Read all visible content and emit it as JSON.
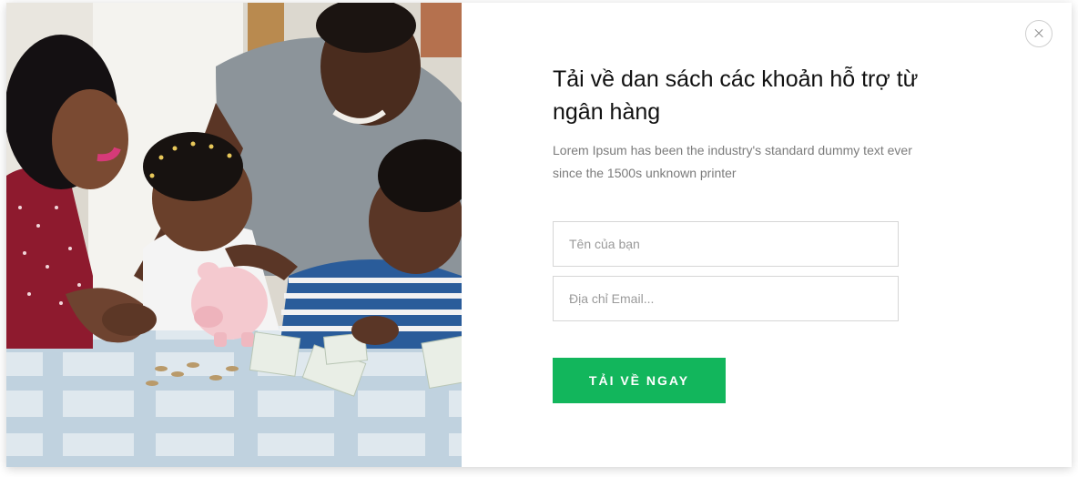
{
  "modal": {
    "title": "Tải về dan sách các khoản hỗ trợ từ ngân hàng",
    "description": "Lorem Ipsum has been the industry's standard dummy text ever since the 1500s unknown printer",
    "name_placeholder": "Tên của bạn",
    "email_placeholder": "Địa chỉ Email...",
    "submit_label": "TẢI VỀ NGAY",
    "close_icon": "close-icon"
  },
  "photo": {
    "subject": "family-saving-money-piggy-bank"
  },
  "colors": {
    "accent": "#12b65c",
    "title_text": "#111111",
    "body_text": "#7b7b7b",
    "field_border": "#d6d6d6"
  }
}
